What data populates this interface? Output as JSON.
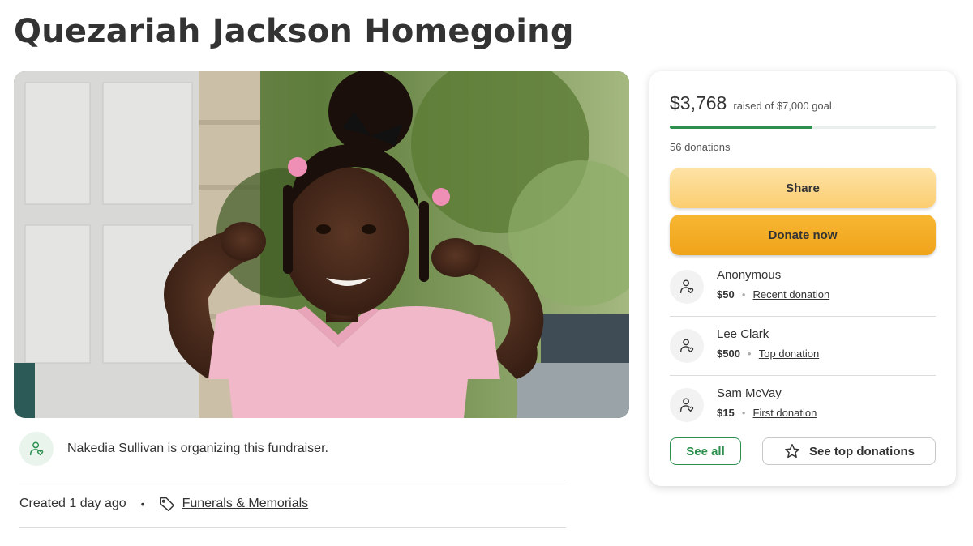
{
  "page": {
    "title": "Quezariah Jackson Homegoing"
  },
  "organizer": {
    "text": "Nakedia Sullivan is organizing this fundraiser.",
    "icon": "person-heart-icon"
  },
  "meta": {
    "created": "Created 1 day ago",
    "separator": "•",
    "category": "Funerals & Memorials",
    "category_icon": "tag-icon"
  },
  "card": {
    "raised_amount": "$3,768",
    "goal_text": "raised of $7,000 goal",
    "progress_fraction": 0.538,
    "donation_count": "56 donations",
    "share_label": "Share",
    "donate_label": "Donate now",
    "donations": [
      {
        "name": "Anonymous",
        "amount": "$50",
        "kind": "Recent donation"
      },
      {
        "name": "Lee Clark",
        "amount": "$500",
        "kind": "Top donation"
      },
      {
        "name": "Sam McVay",
        "amount": "$15",
        "kind": "First donation"
      }
    ],
    "see_all_label": "See all",
    "see_top_label": "See top donations"
  },
  "colors": {
    "brand_green": "#2d8f4e",
    "donate_orange": "#f0a31a",
    "share_yellow": "#fbcd70"
  }
}
